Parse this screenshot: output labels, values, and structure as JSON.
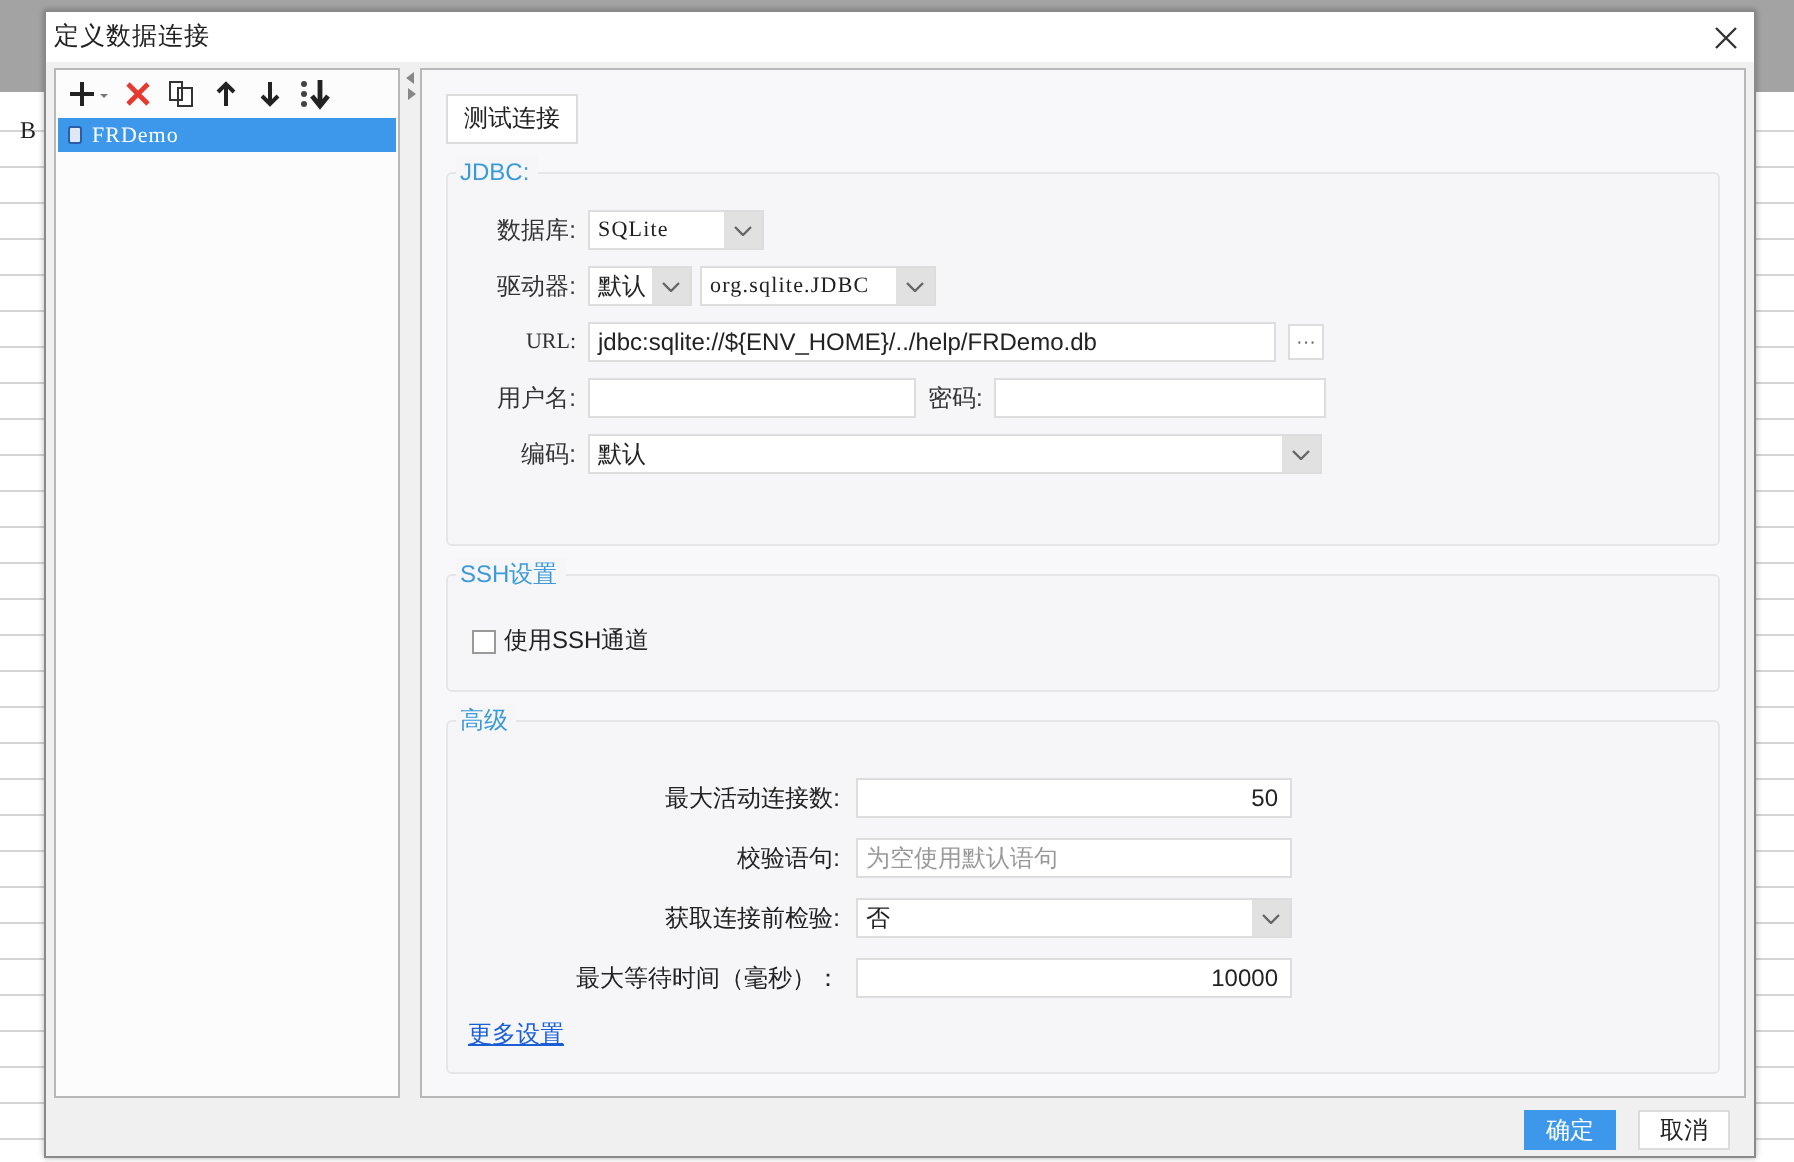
{
  "window": {
    "title": "定义数据连接"
  },
  "background": {
    "column_header": "B"
  },
  "connections": [
    {
      "name": "FRDemo",
      "selected": true
    }
  ],
  "test_button": "测试连接",
  "jdbc": {
    "title": "JDBC:",
    "database": {
      "label": "数据库:",
      "value": "SQLite"
    },
    "driver": {
      "label": "驱动器:",
      "mode": "默认",
      "class": "org.sqlite.JDBC"
    },
    "url": {
      "label": "URL:",
      "value": "jdbc:sqlite://${ENV_HOME}/../help/FRDemo.db",
      "browse": "···"
    },
    "username": {
      "label": "用户名:"
    },
    "password": {
      "label": "密码:"
    },
    "encoding": {
      "label": "编码:",
      "value": "默认"
    }
  },
  "ssh": {
    "title": "SSH设置",
    "use_ssh": {
      "label": "使用SSH通道",
      "checked": false
    }
  },
  "advanced": {
    "title": "高级",
    "fields": [
      {
        "kind": "number",
        "label": "最大活动连接数:",
        "value": "50"
      },
      {
        "kind": "text",
        "label": "校验语句:",
        "placeholder": "为空使用默认语句"
      },
      {
        "kind": "select",
        "label": "获取连接前检验:",
        "value": "否"
      },
      {
        "kind": "number",
        "label": "最大等待时间（毫秒）：",
        "value": "10000"
      }
    ],
    "more_link": "更多设置"
  },
  "buttons": [
    {
      "label": "确定",
      "primary": true
    },
    {
      "label": "取消",
      "primary": false
    }
  ]
}
